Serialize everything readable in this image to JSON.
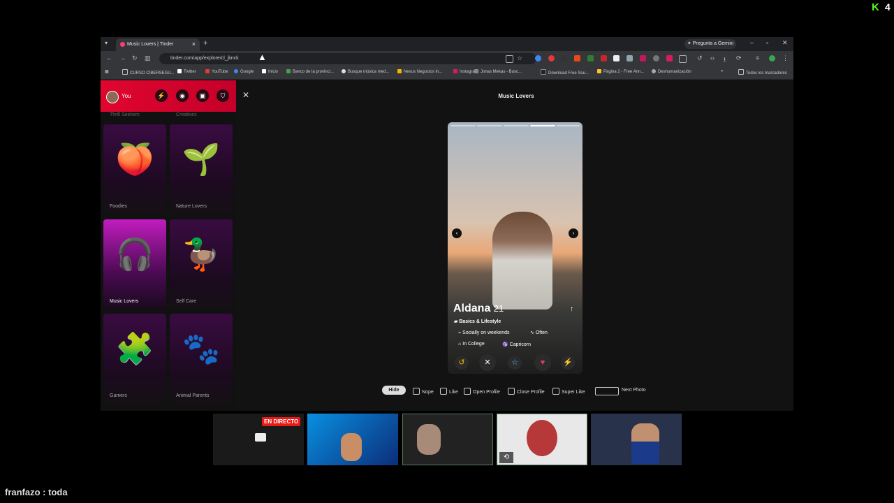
{
  "overlay": {
    "kick_logo": "K",
    "viewer_count": "4",
    "live_badge": "EN DIRECTO",
    "chat_line": "franfazo : toda"
  },
  "browser": {
    "tab_title": "Music Lovers | Tinder",
    "new_tab": "+",
    "gemini": "✦ Pregunta a Gemini",
    "url": "tinder.com/app/explore/cl_jknck",
    "bookmarks": [
      "CURSO CIBERSEGU...",
      "Twitter",
      "YouTube",
      "Google",
      "Inicio",
      "Banco de la provinci...",
      "Busque música med...",
      "Nexus Negocios In...",
      "Instagram",
      "Jonas Mekas - Busc...",
      "Download Free Sou...",
      "Página 2 - Free Ann...",
      "Deshumanización",
      "Todos los marcadores"
    ],
    "overflow": "»"
  },
  "sidebar": {
    "user_label": "You",
    "cut_labels": [
      "Thrill Seekers",
      "Creatives"
    ],
    "tiles": [
      {
        "label": "Foodies",
        "icon": "peach-icon",
        "glyph": "🍑"
      },
      {
        "label": "Nature Lovers",
        "icon": "sprout-icon",
        "glyph": "🌱"
      },
      {
        "label": "Music Lovers",
        "icon": "headphones-icon",
        "glyph": "🎧"
      },
      {
        "label": "Self Care",
        "icon": "rubber-duck-icon",
        "glyph": "🦆"
      },
      {
        "label": "Gamers",
        "icon": "puzzle-icon",
        "glyph": "🧩"
      },
      {
        "label": "Animal Parents",
        "icon": "paw-icon",
        "glyph": "🐾"
      }
    ]
  },
  "main": {
    "title": "Music Lovers",
    "close": "✕"
  },
  "profile": {
    "name": "Aldana",
    "age": "21",
    "section": "Basics & Lifestyle",
    "chips": [
      "Socially on weekends",
      "Often",
      "In College",
      "Capricorn"
    ],
    "photo_count": 5,
    "photo_index": 4
  },
  "shortcuts": {
    "hide": "Hide",
    "nope": "Nope",
    "like": "Like",
    "open_profile": "Open Profile",
    "close_profile": "Close Profile",
    "super_like": "Super Like",
    "next_photo": "Next Photo"
  },
  "colors": {
    "tinder_red": "#e0062e",
    "selected_tile": "#c21cbf",
    "kick_green": "#53fc18"
  }
}
